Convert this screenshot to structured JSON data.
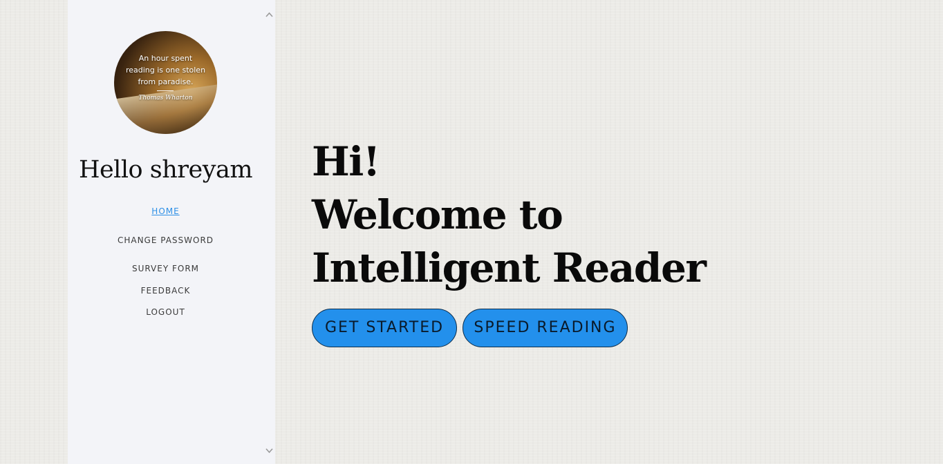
{
  "sidebar": {
    "avatar": {
      "quote": "An hour spent\nreading is one stolen\nfrom paradise.",
      "author": "Thomas Wharton"
    },
    "greeting": "Hello shreyam",
    "nav": [
      {
        "label": "HOME",
        "active": true
      },
      {
        "label": "CHANGE PASSWORD",
        "active": false
      },
      {
        "label": "SURVEY FORM",
        "active": false
      },
      {
        "label": "FEEDBACK",
        "active": false
      },
      {
        "label": "LOGOUT",
        "active": false
      }
    ]
  },
  "main": {
    "headline_lines": [
      "Hi!",
      "Welcome to",
      "Intelligent Reader"
    ],
    "buttons": {
      "get_started": "GET STARTED",
      "speed_reading": "SPEED READING"
    }
  },
  "colors": {
    "accent": "#2390ec",
    "active_link": "#2d8fe6",
    "sidebar_bg": "#f3f4f8",
    "page_bg": "#ecebe7"
  },
  "icons": {
    "scroll_up": "chevron-up-icon",
    "scroll_down": "chevron-down-icon"
  }
}
